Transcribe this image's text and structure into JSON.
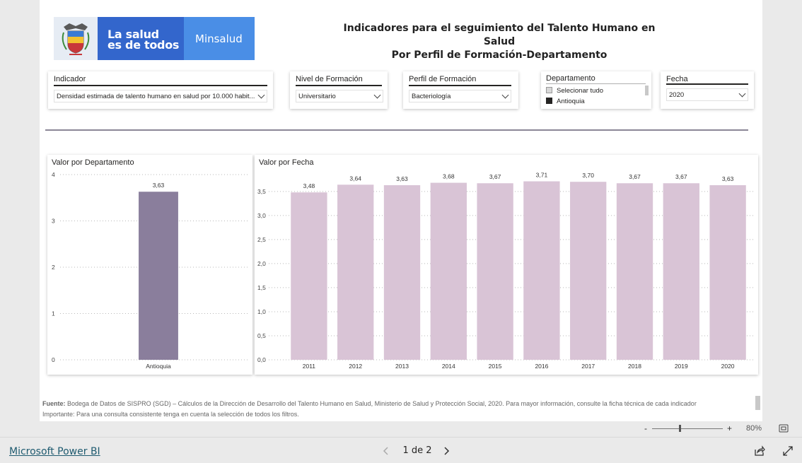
{
  "logo": {
    "slogan_line1": "La salud",
    "slogan_line2": "es de todos",
    "brand": "Minsalud"
  },
  "report_title": {
    "line1": "Indicadores  para el seguimiento del Talento Humano en Salud",
    "line2": "Por Perfil de Formación-Departamento"
  },
  "slicers": {
    "indicador": {
      "label": "Indicador",
      "value": "Densidad estimada de talento humano en salud por 10.000 habit..."
    },
    "nivel": {
      "label": "Nivel de Formación",
      "value": "Universitario"
    },
    "perfil": {
      "label": "Perfil de Formación",
      "value": "Bacteriología"
    },
    "departamento": {
      "label": "Departamento",
      "option_all": "Selecionar tudo",
      "option_1": "Antioquia"
    },
    "fecha": {
      "label": "Fecha",
      "value": "2020"
    }
  },
  "panels": {
    "left_title": "Valor por Departamento",
    "right_title": "Valor por Fecha"
  },
  "chart_data": [
    {
      "type": "bar",
      "title": "Valor por Departamento",
      "categories": [
        "Antioquia"
      ],
      "values": [
        3.63
      ],
      "value_labels": [
        "3,63"
      ],
      "yticks": [
        "0",
        "1",
        "2",
        "3",
        "4"
      ],
      "ylim": [
        0,
        4
      ],
      "color": "#8a7e9c",
      "grid": "dotted"
    },
    {
      "type": "bar",
      "title": "Valor por Fecha",
      "categories": [
        "2011",
        "2012",
        "2013",
        "2014",
        "2015",
        "2016",
        "2017",
        "2018",
        "2019",
        "2020"
      ],
      "values": [
        3.48,
        3.64,
        3.63,
        3.68,
        3.67,
        3.71,
        3.7,
        3.67,
        3.67,
        3.63
      ],
      "value_labels": [
        "3,48",
        "3,64",
        "3,63",
        "3,68",
        "3,67",
        "3,71",
        "3,70",
        "3,67",
        "3,67",
        "3,63"
      ],
      "yticks": [
        "0,0",
        "0,5",
        "1,0",
        "1,5",
        "2,0",
        "2,5",
        "3,0",
        "3,5"
      ],
      "ylim": [
        0,
        3.85
      ],
      "color": "#d9c4d6",
      "grid": "dotted"
    }
  ],
  "footer": {
    "source_label": "Fuente:",
    "source_text": " Bodega de Datos de SISPRO (SGD) – Cálculos de la Dirección de Desarrollo del Talento Humano en Salud, Ministerio de Salud y Protección Social, 2020. Para mayor información, consulte la ficha técnica de cada indicador",
    "note": "Importante: Para una consulta consistente tenga en cuenta la selección de todos los filtros."
  },
  "zoom": {
    "minus": "-",
    "plus": "+",
    "level": "80%",
    "level_fraction": 0.8
  },
  "bottom": {
    "product_link": "Microsoft Power BI",
    "page_indicator": "1 de 2"
  },
  "colors": {
    "dept_bar": "#8a7e9c",
    "year_bar": "#d9c4d6",
    "divider": "#8b8696",
    "logo_blue": "#3366cc",
    "logo_light_blue": "#4a8ee6"
  }
}
